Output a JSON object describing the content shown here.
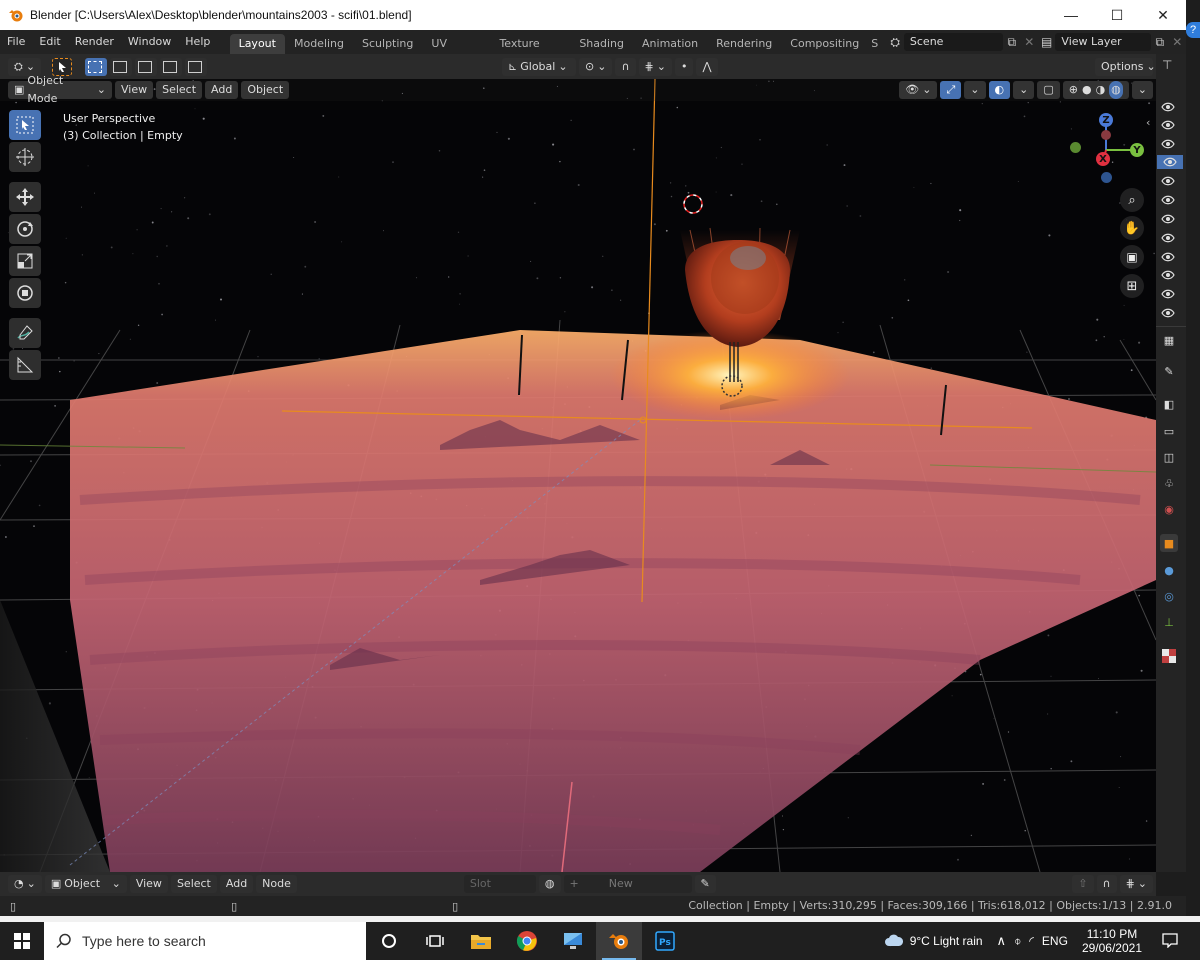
{
  "window": {
    "title": "Blender [C:\\Users\\Alex\\Desktop\\blender\\mountains2003 - scifi\\01.blend]",
    "minimize": "—",
    "maximize": "☐",
    "close": "✕",
    "help": "?"
  },
  "topbar": {
    "menus": [
      "File",
      "Edit",
      "Render",
      "Window",
      "Help"
    ],
    "workspaces": [
      "Layout",
      "Modeling",
      "Sculpting",
      "UV Editing",
      "Texture Paint",
      "Shading",
      "Animation",
      "Rendering",
      "Compositing",
      "S"
    ],
    "active_workspace": "Layout",
    "scene": "Scene",
    "view_layer": "View Layer"
  },
  "header": {
    "transform_orientation": "Global",
    "options_label": "Options",
    "mode": "Object Mode",
    "menus": [
      "View",
      "Select",
      "Add",
      "Object"
    ]
  },
  "viewport": {
    "perspective_label": "User Perspective",
    "collection_label": "(3) Collection | Empty",
    "gizmo_axes": {
      "z": "Z",
      "y": "Y",
      "x": "X"
    }
  },
  "bottom_header": {
    "mode": "Object",
    "menus": [
      "View",
      "Select",
      "Add",
      "Node"
    ],
    "slot": "Slot",
    "new_label": "New"
  },
  "statusbar": {
    "text": "Collection | Empty | Verts:310,295 | Faces:309,166 | Tris:618,012 | Objects:1/13 | 2.91.0"
  },
  "taskbar": {
    "search_placeholder": "Type here to search",
    "weather": "9°C  Light rain",
    "language": "ENG",
    "time": "11:10 PM",
    "date": "29/06/2021"
  },
  "colors": {
    "accent_blue": "#4772b3",
    "orange_axis": "#e88b1e",
    "fog_pink": "#c96a74",
    "planet": "#c24a25"
  },
  "icons": {
    "blender": "blender-logo-icon",
    "windows": "windows-start-icon",
    "search": "search-icon",
    "cortana": "cortana-circle-icon",
    "task_view": "task-view-icon",
    "explorer": "file-explorer-icon",
    "chrome": "chrome-icon",
    "photoshop": "photoshop-icon"
  }
}
